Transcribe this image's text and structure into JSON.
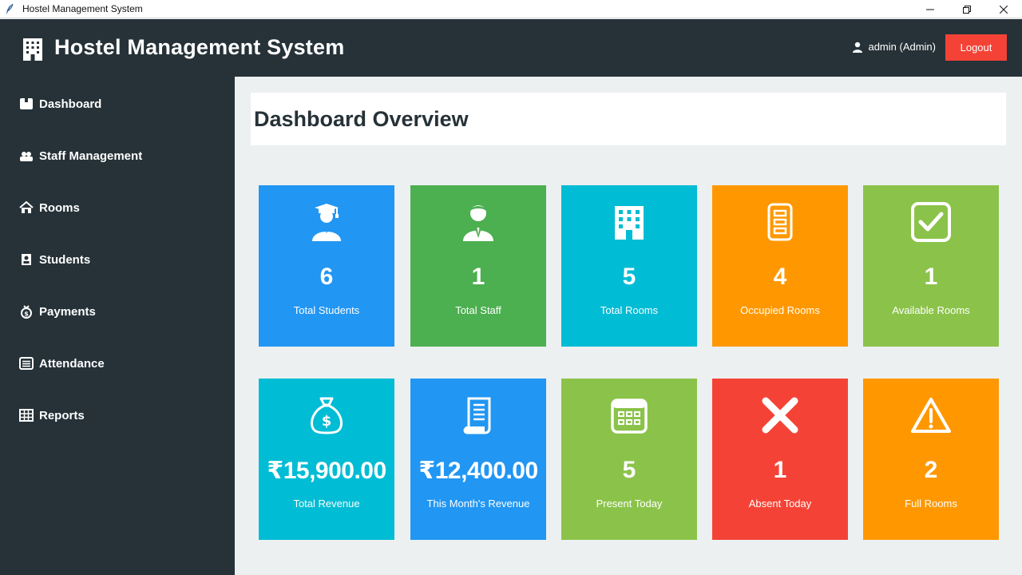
{
  "window": {
    "title": "Hostel Management System"
  },
  "header": {
    "title": "Hostel Management System",
    "user": "admin (Admin)",
    "logout_label": "Logout"
  },
  "sidebar": {
    "items": [
      {
        "label": "Dashboard",
        "icon": "dashboard-icon"
      },
      {
        "label": "Staff Management",
        "icon": "staff-icon"
      },
      {
        "label": "Rooms",
        "icon": "rooms-icon"
      },
      {
        "label": "Students",
        "icon": "students-icon"
      },
      {
        "label": "Payments",
        "icon": "payments-icon"
      },
      {
        "label": "Attendance",
        "icon": "attendance-icon"
      },
      {
        "label": "Reports",
        "icon": "reports-icon"
      }
    ]
  },
  "main": {
    "title": "Dashboard Overview",
    "cards": [
      {
        "value": "6",
        "label": "Total Students",
        "color": "#2196f3",
        "icon": "graduate-icon"
      },
      {
        "value": "1",
        "label": "Total Staff",
        "color": "#4caf50",
        "icon": "staff-person-icon"
      },
      {
        "value": "5",
        "label": "Total Rooms",
        "color": "#00bcd4",
        "icon": "building-icon"
      },
      {
        "value": "4",
        "label": "Occupied Rooms",
        "color": "#ff9800",
        "icon": "door-icon"
      },
      {
        "value": "1",
        "label": "Available Rooms",
        "color": "#8bc34a",
        "icon": "checkbox-icon"
      },
      {
        "value": "₹15,900.00",
        "label": "Total Revenue",
        "color": "#00bcd4",
        "icon": "money-bag-icon"
      },
      {
        "value": "₹12,400.00",
        "label": "This Month's Revenue",
        "color": "#2196f3",
        "icon": "receipt-icon"
      },
      {
        "value": "5",
        "label": "Present Today",
        "color": "#8bc34a",
        "icon": "calendar-icon"
      },
      {
        "value": "1",
        "label": "Absent Today",
        "color": "#f44336",
        "icon": "cross-icon"
      },
      {
        "value": "2",
        "label": "Full Rooms",
        "color": "#ff9800",
        "icon": "warning-icon"
      }
    ]
  }
}
